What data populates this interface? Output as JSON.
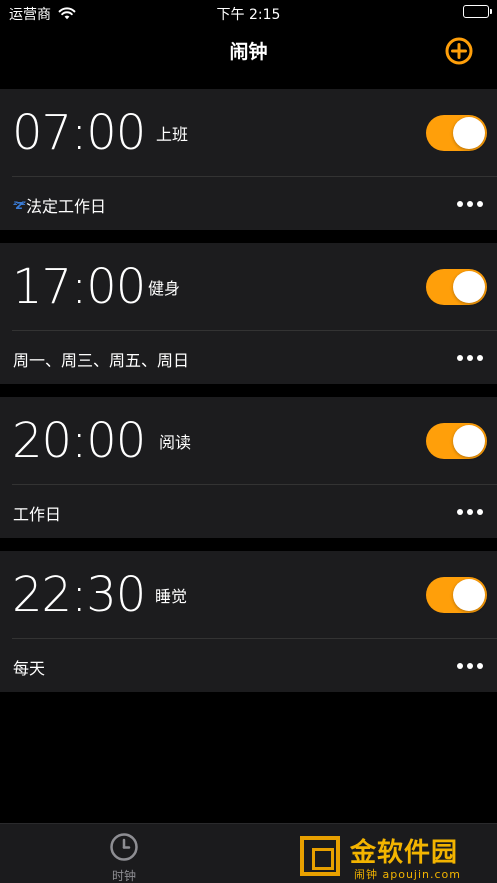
{
  "status_bar": {
    "carrier": "运营商",
    "time": "下午 2:15"
  },
  "nav": {
    "title": "闹钟",
    "add_icon": "plus-circle-icon"
  },
  "accent_color": "#ff9f0a",
  "alarms": [
    {
      "time": "07:00",
      "label": "上班",
      "enabled": true,
      "repeat": "法定工作日",
      "snooze_icon": "zzz-icon"
    },
    {
      "time": "17:00",
      "label": "健身",
      "enabled": true,
      "repeat": "周一、周三、周五、周日"
    },
    {
      "time": "20:00",
      "label": "阅读",
      "enabled": true,
      "repeat": "工作日"
    },
    {
      "time": "22:30",
      "label": "睡觉",
      "enabled": true,
      "repeat": "每天"
    }
  ],
  "tab_bar": {
    "tabs": [
      {
        "label": "时钟",
        "icon": "clock-icon"
      }
    ]
  },
  "watermark": {
    "text": "金软件园",
    "sub": "闹钟 apoujin.com"
  }
}
